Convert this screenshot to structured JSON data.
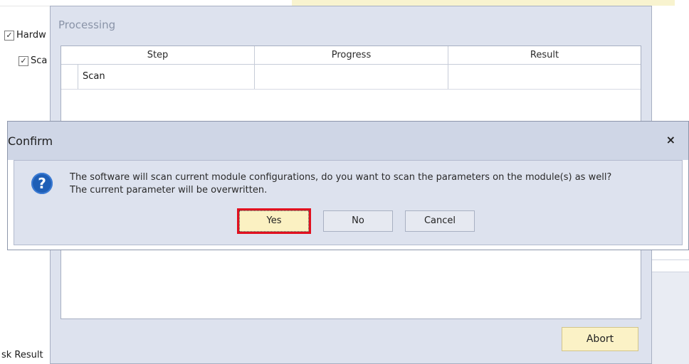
{
  "background": {
    "tree": {
      "item1": {
        "checked": true,
        "label": "Hardw"
      },
      "item2": {
        "checked": true,
        "label": "Sca"
      }
    },
    "bottom_tab_label": "sk Result",
    "check_glyph": "✓"
  },
  "processing": {
    "title": "Processing",
    "grid": {
      "columns": [
        "Step",
        "Progress",
        "Result"
      ],
      "rows": [
        {
          "step": "Scan",
          "progress": "",
          "result": ""
        }
      ]
    },
    "abort_label": "Abort"
  },
  "confirm": {
    "title": "Confirm",
    "close_glyph": "×",
    "icon": "question-icon",
    "icon_glyph": "?",
    "message_line1": "The software will scan current module configurations, do you want to scan the parameters on the module(s) as well?",
    "message_line2": "The current parameter will be overwritten.",
    "buttons": {
      "yes": "Yes",
      "no": "No",
      "cancel": "Cancel"
    },
    "highlight_color": "#e1101f"
  }
}
